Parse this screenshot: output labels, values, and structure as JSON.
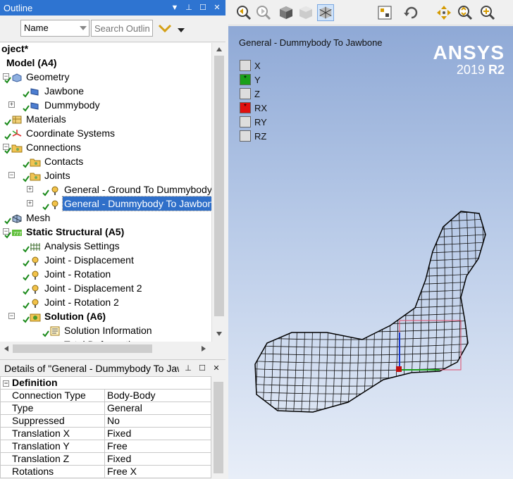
{
  "outline": {
    "title": "Outline",
    "name_select": "Name",
    "search_placeholder": "Search Outline"
  },
  "tree": [
    {
      "label": "oject*",
      "bold": true
    },
    {
      "label": "Model (A4)",
      "bold": true
    },
    {
      "label": "Geometry"
    },
    {
      "label": "Jawbone"
    },
    {
      "label": "Dummybody"
    },
    {
      "label": "Materials"
    },
    {
      "label": "Coordinate Systems"
    },
    {
      "label": "Connections"
    },
    {
      "label": "Contacts"
    },
    {
      "label": "Joints"
    },
    {
      "label": "General - Ground To Dummybody"
    },
    {
      "label": "General - Dummybody To Jawbone"
    },
    {
      "label": "Mesh"
    },
    {
      "label": "Static Structural (A5)",
      "bold": true
    },
    {
      "label": "Analysis Settings"
    },
    {
      "label": "Joint - Displacement"
    },
    {
      "label": "Joint - Rotation"
    },
    {
      "label": "Joint - Displacement 2"
    },
    {
      "label": "Joint - Rotation 2"
    },
    {
      "label": "Solution (A6)",
      "bold": true
    },
    {
      "label": "Solution Information"
    },
    {
      "label": "Total Deformation"
    }
  ],
  "details": {
    "title": "Details of \"General - Dummybody To Jawbone\"",
    "section": "Definition",
    "rows": [
      {
        "key": "Connection Type",
        "value": "Body-Body"
      },
      {
        "key": "Type",
        "value": "General"
      },
      {
        "key": "Suppressed",
        "value": "No"
      },
      {
        "key": "Translation X",
        "value": "Fixed"
      },
      {
        "key": "Translation Y",
        "value": "Free"
      },
      {
        "key": "Translation Z",
        "value": "Fixed"
      },
      {
        "key": "Rotations",
        "value": "Free X"
      }
    ]
  },
  "viewport": {
    "title": "General - Dummybody To Jawbone",
    "logo": "ANSYS",
    "version_year": "2019",
    "version_rel": "R2",
    "dof": [
      {
        "label": "X",
        "state": "fixed"
      },
      {
        "label": "Y",
        "state": "free"
      },
      {
        "label": "Z",
        "state": "fixed"
      },
      {
        "label": "RX",
        "state": "free-rot"
      },
      {
        "label": "RY",
        "state": "fixed"
      },
      {
        "label": "RZ",
        "state": "fixed"
      }
    ]
  },
  "colors": {
    "title_bar": "#2e74d1",
    "selection": "#2f6fc9",
    "dof_free": "#1aa01a",
    "dof_rot": "#e01010",
    "viewport_top": "#8fa9d6",
    "viewport_bottom": "#e8eef8"
  }
}
